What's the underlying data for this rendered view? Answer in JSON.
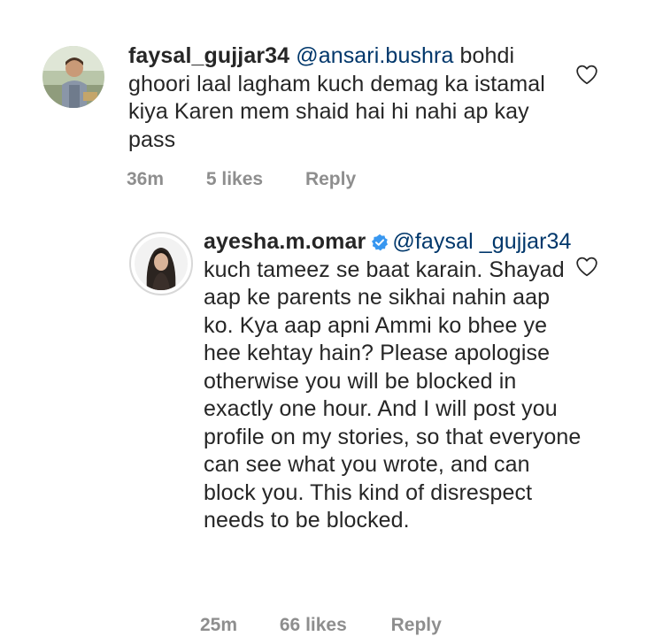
{
  "comments": [
    {
      "username": "faysal_gujjar34",
      "mention": "@ansari.bushra",
      "body": " bohdi ghoori laal lagham kuch demag ka istamal kiya Karen mem shaid hai hi nahi ap kay pass",
      "time": "36m",
      "likes": "5 likes",
      "reply_label": "Reply",
      "avatar_icon": "profile-photo-child",
      "verified": false
    },
    {
      "username": "ayesha.m.omar",
      "mention": "@faysal _gujjar34",
      "body": " kuch tameez se baat karain. Shayad aap ke parents ne sikhai nahin aap ko. Kya aap apni Ammi ko bhee ye hee kehtay hain? Please apologise otherwise you will be blocked in exactly one hour. And I will post you profile on my stories, so that everyone can see what you wrote, and can block you. This kind of disrespect needs to be blocked.",
      "time": "25m",
      "likes": "66 likes",
      "reply_label": "Reply",
      "avatar_icon": "profile-photo-woman",
      "verified": true
    }
  ],
  "icons": {
    "like": "heart-outline-icon",
    "verified": "verified-badge-icon"
  },
  "colors": {
    "mention": "#00376b",
    "meta": "#8e8e8e",
    "verified": "#3897f0",
    "text": "#262626"
  }
}
